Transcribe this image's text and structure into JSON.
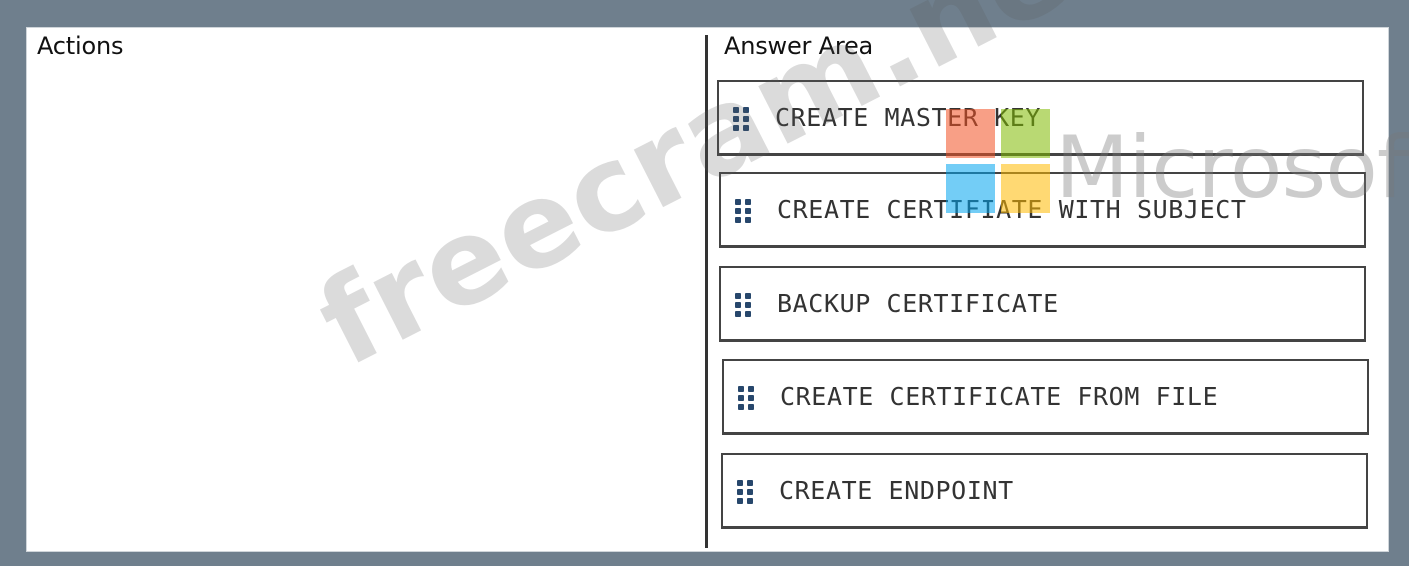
{
  "headers": {
    "actions": "Actions",
    "answer_area": "Answer Area"
  },
  "answer_items": [
    {
      "label": "CREATE MASTER KEY"
    },
    {
      "label": "CREATE CERTIFIATE WITH SUBJECT"
    },
    {
      "label": "BACKUP CERTIFICATE"
    },
    {
      "label": "CREATE CERTIFICATE FROM FILE"
    },
    {
      "label": "CREATE ENDPOINT"
    }
  ],
  "watermarks": {
    "site": "freecram.net",
    "brand": "Microsoft",
    "brand_colors": {
      "red": "#f25022",
      "green": "#7fba00",
      "blue": "#00a4ef",
      "yellow": "#ffb900"
    }
  },
  "colors": {
    "frame": "#6f7f8d",
    "panel": "#ffffff",
    "item_border": "#444444",
    "grip_dots": "#27476c"
  },
  "icons": {
    "drag_handle": "drag-handle-icon"
  }
}
